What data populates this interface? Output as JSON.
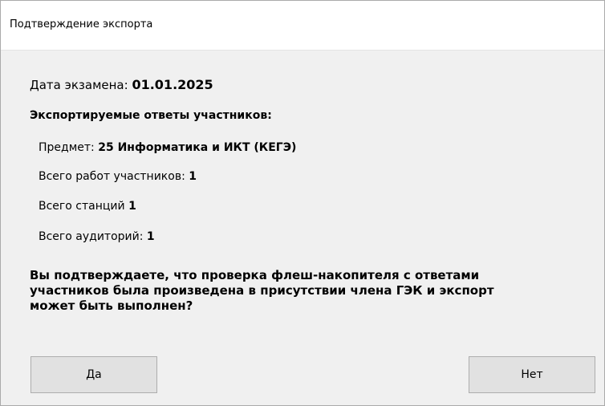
{
  "window": {
    "title": "Подтверждение экспорта"
  },
  "exam_date": {
    "label": "Дата экзамена:",
    "value": "01.01.2025"
  },
  "section_heading": "Экспортируемые ответы участников:",
  "details": {
    "subject": {
      "label": "Предмет:",
      "value": "25 Информатика и ИКТ (КЕГЭ)"
    },
    "works": {
      "label": "Всего работ участников:",
      "value": "1"
    },
    "stations": {
      "label": "Всего станций",
      "value": "1"
    },
    "rooms": {
      "label": "Всего аудиторий:",
      "value": "1"
    }
  },
  "question": {
    "line1": "Вы подтверждаете, что проверка флеш-накопителя с ответами",
    "line2": "участников была произведена в присутствии члена ГЭК и экспорт",
    "line3": "может быть выполнен?"
  },
  "buttons": {
    "yes_label": "Да",
    "no_label": "Нет"
  },
  "colors": {
    "dialog_background": "#f0f0f0",
    "titlebar_background": "#ffffff",
    "button_background": "#e1e1e1",
    "button_border": "#adadad"
  }
}
